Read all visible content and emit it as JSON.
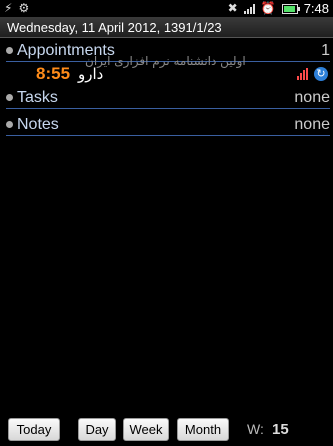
{
  "status_bar": {
    "time": "7:48",
    "icons": [
      "usb-icon",
      "android-debug-icon",
      "mute-icon",
      "signal-icon",
      "alarm-clock-icon",
      "battery-icon"
    ],
    "battery_color": "#55e26a"
  },
  "header": {
    "date_text": "Wednesday, 11 April 2012, 1391/1/23"
  },
  "sections": {
    "appointments": {
      "label": "Appointments",
      "value": "1"
    },
    "tasks": {
      "label": "Tasks",
      "value": "none"
    },
    "notes": {
      "label": "Notes",
      "value": "none"
    }
  },
  "appointment": {
    "time": "8:55",
    "title": "دارو",
    "subtitle": "اولین دانشنامه نرم افزاری ایران",
    "time_color": "#ff8c1a"
  },
  "toolbar": {
    "today_label": "Today",
    "day_label": "Day",
    "week_label": "Week",
    "month_label": "Month",
    "week_prefix": "W:",
    "week_number": "15"
  },
  "accent_colors": {
    "section_label": "#c7d7ee",
    "divider": "#3a5fa0"
  }
}
